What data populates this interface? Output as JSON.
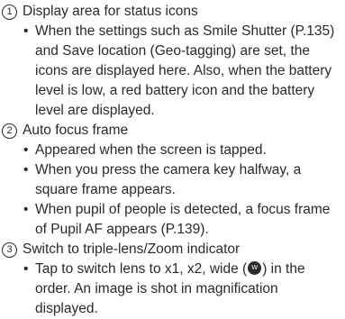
{
  "sections": [
    {
      "number": "1",
      "title": "Display area for status icons",
      "bullets": [
        "When the settings such as Smile Shutter (P.135) and Save location (Geo-tagging) are set, the icons are displayed here. Also, when the battery level is low, a red battery icon and the battery level are displayed."
      ]
    },
    {
      "number": "2",
      "title": "Auto focus frame",
      "bullets": [
        "Appeared when the screen is tapped.",
        "When you press the camera key halfway, a square frame appears.",
        "When pupil of people is detected, a focus frame of Pupil AF appears (P.139)."
      ]
    },
    {
      "number": "3",
      "title": "Switch to triple-lens/Zoom indicator",
      "bullet_parts": {
        "before_icon": "Tap to switch lens to x1, x2, wide (",
        "after_icon": ") in the order. An image is shot in magnification displayed."
      }
    }
  ],
  "bullet_symbol": "•",
  "icons": {
    "wide_lens": "wide-lens-icon"
  }
}
